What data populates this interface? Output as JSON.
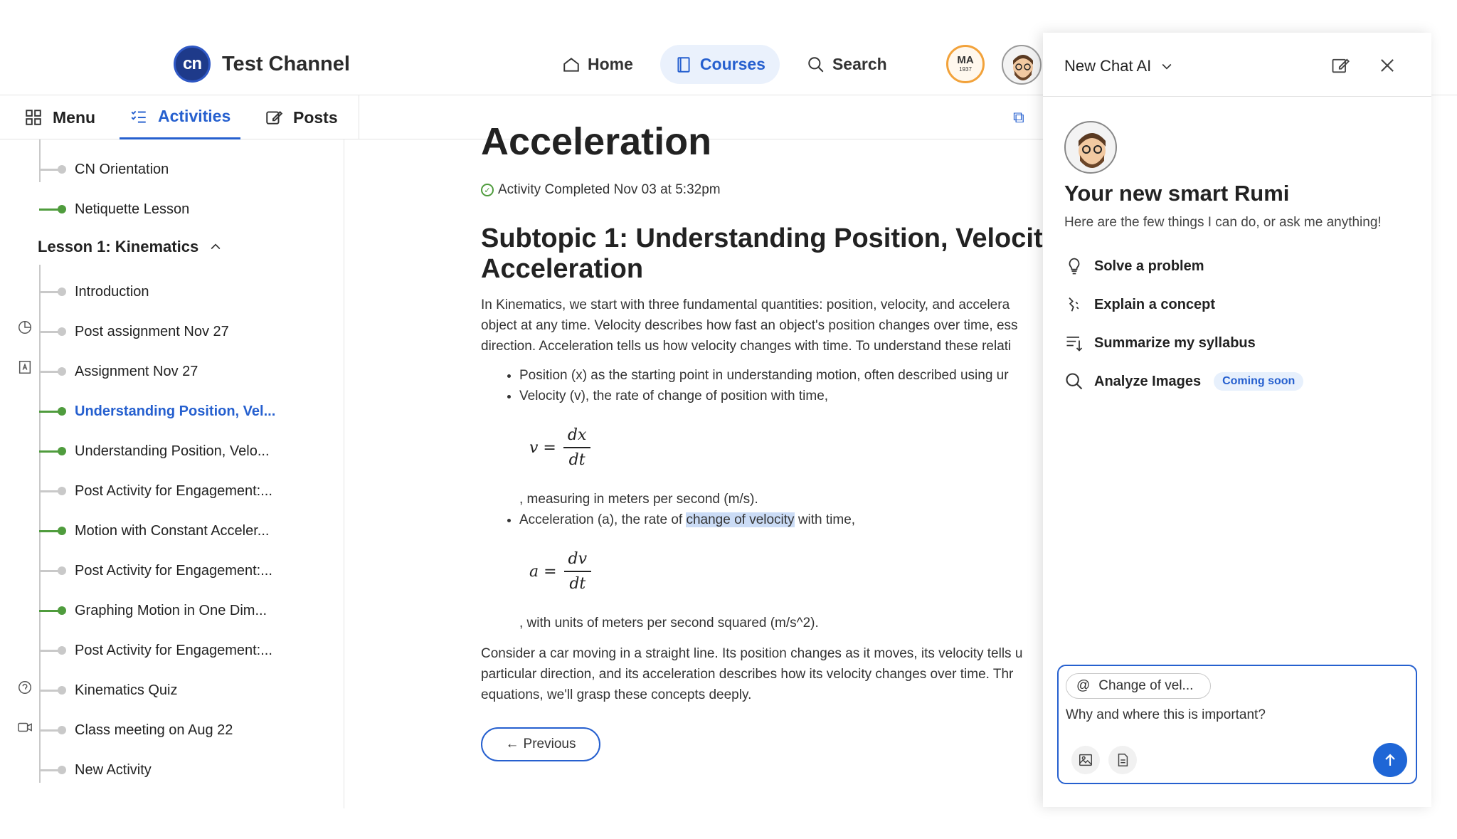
{
  "header": {
    "brand_logo": "cn",
    "brand_name": "Test Channel",
    "nav": [
      {
        "label": "Home",
        "icon": "home-icon",
        "active": false
      },
      {
        "label": "Courses",
        "icon": "book-icon",
        "active": true
      },
      {
        "label": "Search",
        "icon": "search-icon",
        "active": false
      }
    ],
    "badge_avatar": {
      "initials": "MA",
      "year": "1937"
    }
  },
  "subtabs": [
    {
      "label": "Menu",
      "icon": "grid-icon",
      "active": false
    },
    {
      "label": "Activities",
      "icon": "checklist-icon",
      "active": true
    },
    {
      "label": "Posts",
      "icon": "edit-icon",
      "active": false
    }
  ],
  "sidebar": {
    "top_items": [
      {
        "label": "CN Orientation",
        "status": "pending"
      },
      {
        "label": "Netiquette Lesson",
        "status": "done"
      }
    ],
    "lesson_title": "Lesson 1: Kinematics",
    "lesson_items": [
      {
        "label": "Introduction",
        "status": "pending",
        "icon": ""
      },
      {
        "label": "Post assignment Nov 27",
        "status": "pending",
        "icon": "pie-icon"
      },
      {
        "label": "Assignment Nov 27",
        "status": "pending",
        "icon": "assignment-icon"
      },
      {
        "label": "Understanding Position, Vel...",
        "status": "current",
        "icon": ""
      },
      {
        "label": "Understanding Position, Velo...",
        "status": "done",
        "icon": ""
      },
      {
        "label": "Post Activity for Engagement:...",
        "status": "pending",
        "icon": ""
      },
      {
        "label": "Motion with Constant Acceler...",
        "status": "done",
        "icon": ""
      },
      {
        "label": "Post Activity for Engagement:...",
        "status": "pending",
        "icon": ""
      },
      {
        "label": "Graphing Motion in One Dim...",
        "status": "done",
        "icon": ""
      },
      {
        "label": "Post Activity for Engagement:...",
        "status": "pending",
        "icon": ""
      },
      {
        "label": "Kinematics Quiz",
        "status": "pending",
        "icon": "quiz-icon"
      },
      {
        "label": "Class meeting on Aug 22",
        "status": "pending",
        "icon": "video-icon"
      },
      {
        "label": "New Activity",
        "status": "pending",
        "icon": ""
      }
    ]
  },
  "content": {
    "title": "Acceleration",
    "completed": "Activity Completed Nov 03 at 5:32pm",
    "subtopic_line1": "Subtopic 1: Understanding Position, Velocit",
    "subtopic_line2": "Acceleration",
    "intro": [
      "In Kinematics, we start with three fundamental quantities: position, velocity, and accelera",
      "object at any time. Velocity describes how fast an object's position changes over time, ess",
      "direction. Acceleration tells us how velocity changes with time. To understand these relati"
    ],
    "bullet1": "Position (x) as the starting point in understanding motion, often described using ur",
    "bullet2": "Velocity (v), the rate of change of position with time,",
    "formula1": {
      "lhs": "v =",
      "num": "dx",
      "den": "dt"
    },
    "tail1": ", measuring in meters per second (m/s).",
    "bullet3_pre": "Acceleration (a), the rate of ",
    "bullet3_hl": "change of velocity",
    "bullet3_post": " with time,",
    "formula2": {
      "lhs": "a =",
      "num": "dv",
      "den": "dt"
    },
    "tail2": ", with units of meters per second squared (m/s^2).",
    "outro": [
      "Consider a car moving in a straight line. Its position changes as it moves, its velocity tells u",
      "particular direction, and its acceleration describes how its velocity changes over time. Thr",
      "equations, we'll grasp these concepts deeply."
    ],
    "prev_label": "Previous"
  },
  "chat": {
    "title": "New Chat AI",
    "bot_title": "Your new smart Rumi",
    "bot_sub": "Here are the few things I can do, or ask me anything!",
    "suggestions": [
      {
        "label": "Solve a problem",
        "icon": "lightbulb-icon"
      },
      {
        "label": "Explain a concept",
        "icon": "concept-icon"
      },
      {
        "label": "Summarize my syllabus",
        "icon": "summarize-icon"
      },
      {
        "label": "Analyze Images",
        "icon": "search-icon",
        "badge": "Coming soon"
      }
    ],
    "chip": {
      "at": "@",
      "label": "Change of vel..."
    },
    "message": "Why and where this is important?",
    "accent": "#1f66d6"
  }
}
